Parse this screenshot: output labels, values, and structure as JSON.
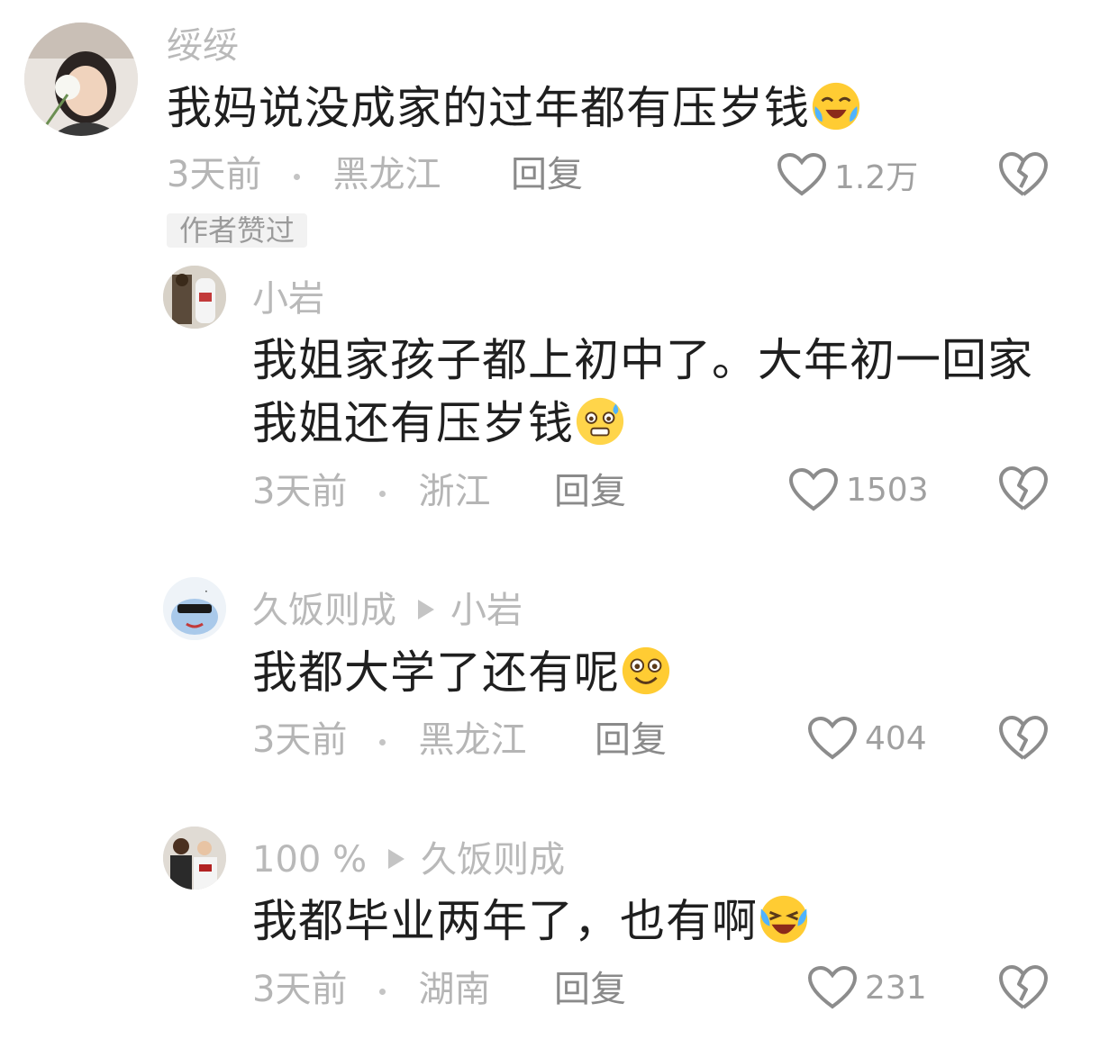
{
  "comments": [
    {
      "username": "绥绥",
      "text": "我妈说没成家的过年都有压岁钱",
      "emoji": "crying-laughing-emoji",
      "time": "3天前",
      "location": "黑龙江",
      "reply_label": "回复",
      "likes": "1.2万",
      "badge": "作者赞过"
    },
    {
      "username": "小岩",
      "text_line1": "我姐家孩子都上初中了。大年初一回家",
      "text_line2": "我姐还有压岁钱",
      "emoji": "sweating-shy-emoji",
      "time": "3天前",
      "location": "浙江",
      "reply_label": "回复",
      "likes": "1503"
    },
    {
      "username": "久饭则成",
      "reply_to": "小岩",
      "text": "我都大学了还有呢",
      "emoji": "smile-emoji",
      "time": "3天前",
      "location": "黑龙江",
      "reply_label": "回复",
      "likes": "404"
    },
    {
      "username": "100 %",
      "reply_to": "久饭则成",
      "text": "我都毕业两年了，也有啊",
      "emoji": "laughing-tears-emoji",
      "time": "3天前",
      "location": "湖南",
      "reply_label": "回复",
      "likes": "231"
    }
  ],
  "colors": {
    "text": "#1f1f1f",
    "meta": "#b5b5b5",
    "icon": "#8c8c8c"
  }
}
